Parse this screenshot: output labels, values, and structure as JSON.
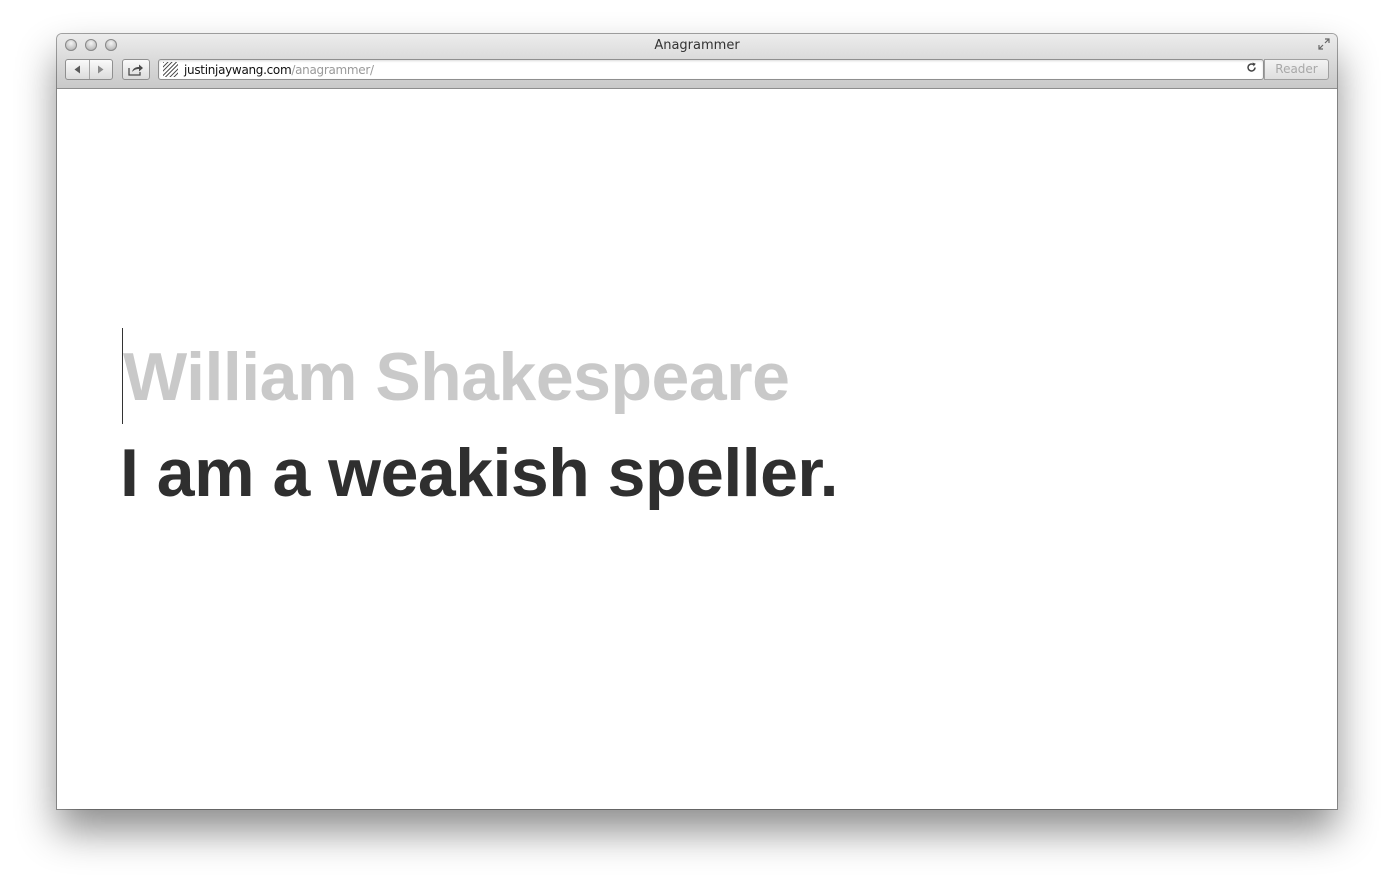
{
  "window": {
    "title": "Anagrammer"
  },
  "toolbar": {
    "url_host": "justinjaywang.com",
    "url_path": "/anagrammer/",
    "reader_label": "Reader"
  },
  "page": {
    "input_text": "William Shakespeare",
    "anagram_text": "I am a weakish speller."
  },
  "icons": {
    "back": "back-arrow-icon",
    "forward": "forward-arrow-icon",
    "share": "share-icon",
    "reload": "reload-icon",
    "fullscreen": "fullscreen-icon"
  },
  "colors": {
    "input_text": "#c9c9c9",
    "anagram_text": "#2f2f2f"
  }
}
